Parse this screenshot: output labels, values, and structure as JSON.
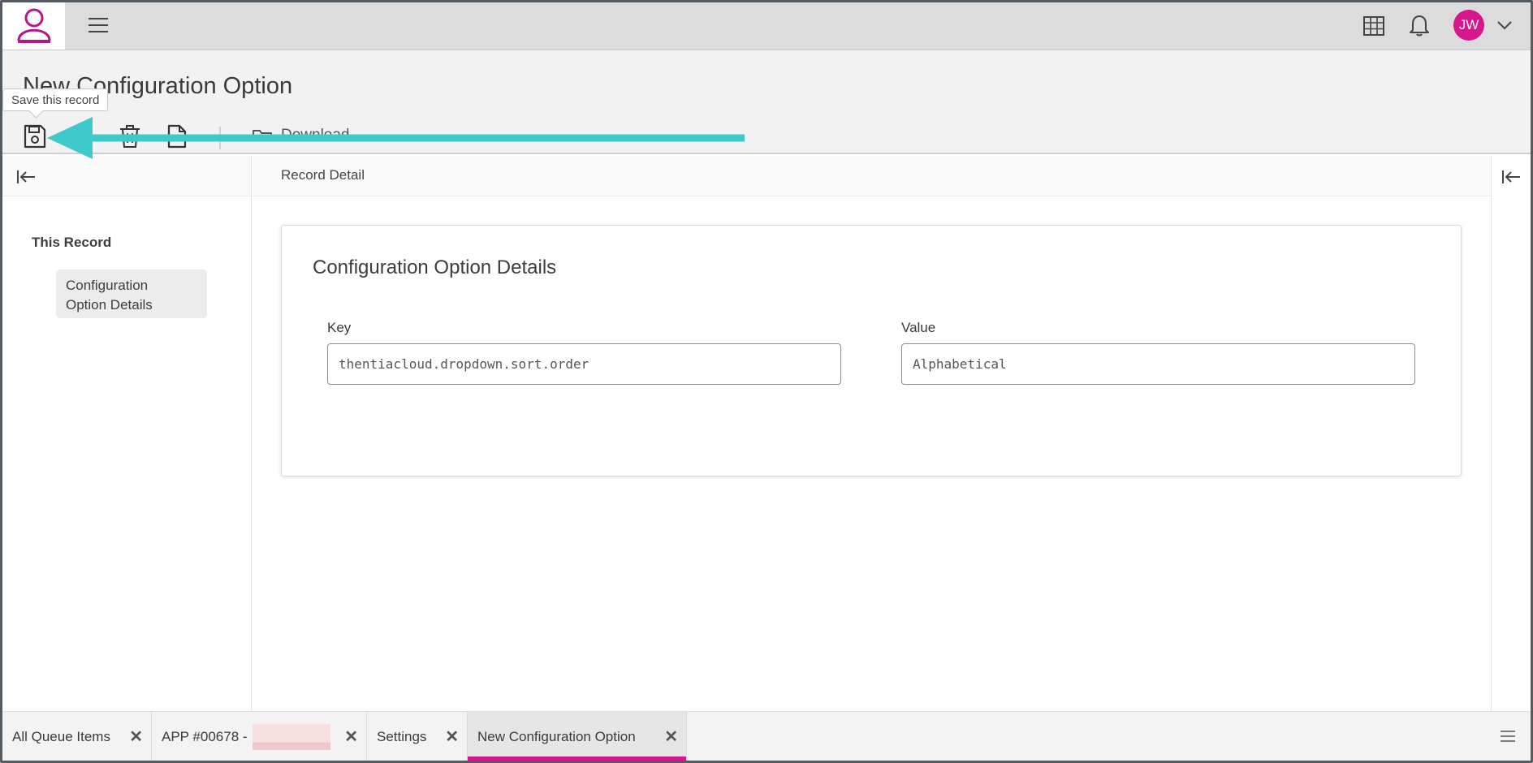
{
  "topbar": {
    "logo_icon": "person-logo-icon",
    "menu_icon": "hamburger-icon",
    "apps_icon": "grid-icon",
    "notifications_icon": "bell-icon",
    "user_initials": "JW",
    "user_menu_icon": "chevron-down-icon",
    "accent_color": "#d6168a"
  },
  "header": {
    "title": "New Configuration Option",
    "tooltip": "Save this record",
    "toolbar": {
      "save_icon": "save-icon",
      "delete_icon": "trash-icon",
      "document_icon": "document-icon",
      "download_icon": "folder-icon",
      "download_label": "Download"
    }
  },
  "left_panel": {
    "section_title": "This Record",
    "items": [
      {
        "label_line1": "Configuration",
        "label_line2": "Option Details"
      }
    ]
  },
  "main": {
    "breadcrumb": "Record Detail",
    "card": {
      "title": "Configuration Option Details",
      "fields": [
        {
          "label": "Key",
          "value": "thentiacloud.dropdown.sort.order"
        },
        {
          "label": "Value",
          "value": "Alphabetical"
        }
      ]
    }
  },
  "bottom_tabs": [
    {
      "label": "All Queue Items"
    },
    {
      "label": "APP #00678 -"
    },
    {
      "label": "Settings"
    },
    {
      "label": "New Configuration Option",
      "active": true
    }
  ],
  "annotation": {
    "color": "#3ec9cb"
  }
}
